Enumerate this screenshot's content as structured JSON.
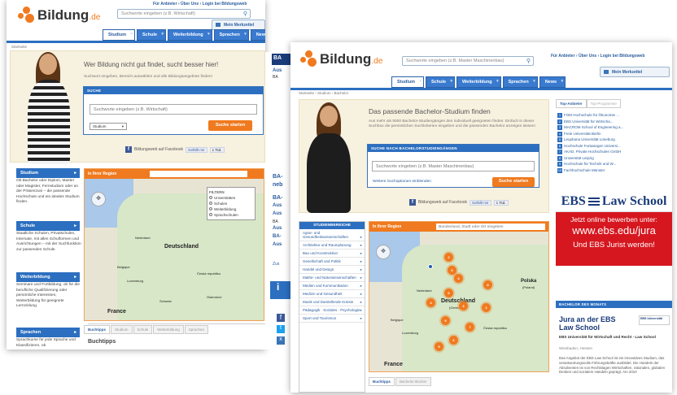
{
  "brand": {
    "name": "Bildung",
    "tld": ".de",
    "color": "#f07a1f",
    "nav_color": "#3a7bd0"
  },
  "back": {
    "search_placeholder": "Suchworte eingeben (z.B. Wirtschaft)",
    "toplinks": "Für Anbieter › Über Uns › Login bei Bildungsweb",
    "merkzettel": "Mein Merkzettel",
    "nav": [
      "Studium",
      "Schule",
      "Weiterbildung",
      "Sprachen",
      "News"
    ],
    "crumb": "Startseite",
    "slogan": "Wer Bildung nicht gut findet, sucht besser hier!",
    "sub": "Suchwort eingeben, Bereich auswählen und alle Bildungsangebote finden!",
    "suche_header": "SUCHE",
    "input": "Suchworte eingeben (z.B. Wirtschaft)",
    "select": "Studium",
    "button": "Suche starten",
    "fb_text": "Bildungsweb auf Facebook",
    "like": "Gefällt mir",
    "like_count": "1 Tsd.",
    "categories": [
      {
        "title": "Studium",
        "text": "Ob Bachelor oder Diplom, Master oder Magister, Fernstudium oder an der Präsenzuni – die passende Hochschule und ein ideales Studium finden."
      },
      {
        "title": "Schule",
        "text": "Staatliche Schulen, Privatschulen, Internate, mit allen Schulformen und Ausrichtungen – mit der Suchfunktion zur passenden Schule."
      },
      {
        "title": "Weiterbildung",
        "text": "Seminare und Fortbildung, ob für die berufliche Qualifizierung oder persönliche Interessen, Weiterbildung für geeignete Lernzielung."
      },
      {
        "title": "Sprachen",
        "text": "Sprachkurse für jede Sprache und Klassifizieren, ob"
      }
    ],
    "map_bar": "In Ihrer Region",
    "filter_title": "FILTERN",
    "filter_items": [
      "Universitäten",
      "Schulen",
      "Weiterbildung",
      "Sprachschulen"
    ],
    "map_labels": {
      "nl": "Nederland",
      "de": "Deutschland",
      "be": "Belgique",
      "lux": "Luxemburg",
      "cz": "Česká republika",
      "fr": "France",
      "ch": "Schweiz",
      "at": "Österreich"
    },
    "tabs": [
      "Buchtipps",
      "Studium",
      "Schule",
      "Weiterbildung",
      "Sprachen"
    ],
    "tab_heading": "Buchtipps",
    "side_peek": [
      "BA",
      "Aus",
      "BA",
      "BA-",
      "neb",
      "BA-",
      "Aus",
      "Aus",
      "BA",
      "Aus",
      "BA-",
      "Aus",
      "Zus"
    ]
  },
  "front": {
    "search_placeholder": "Suchworte eingeben (z.B. Master Maschinenbau)",
    "toplinks": "Für Anbieter › Über Uns › Login bei Bildungsweb",
    "merkzettel": "Mein Merkzettel",
    "nav": [
      "Studium",
      "Schule",
      "Weiterbildung",
      "Sprachen",
      "News"
    ],
    "crumb": "Startseite › Studium › Bachelor",
    "slogan": "Das passende Bachelor-Studium finden",
    "sub": "Aus mehr als 5000 Bachelor-Studiengängen den individuell geeigneten finden: Einfach in dieser Suchbox die persönlichen Suchkriterien eingeben und die passenden Bachelor anzeigen lassen!",
    "suche_header": "SUCHE NACH BACHELORSTUDIENGÄNGEN",
    "input": "Suchworte eingeben (z.B. Master Maschinenbau)",
    "weitere": "Weitere Suchoptionen einblenden",
    "button": "Suche starten",
    "fb_text": "Bildungsweb auf Facebook",
    "like": "Gefällt mir",
    "like_count": "1 Tsd.",
    "side_header": "STUDIENBEREICHE",
    "side_items": [
      "Agrar- und Gesundheitswissenschaften",
      "Architektur und Raumplanung",
      "Bau und Konstruktion",
      "Gesellschaft und Politik",
      "Handel und Design",
      "Mathe- und Naturwissenschaften",
      "Medien und Kommunikation",
      "Medizin und Gesundheit",
      "Musik und Darstellende Künste",
      "Pädagogik · Soziales · Psychologie",
      "Sport und Tourismus"
    ],
    "map_bar": "In Ihrer Region",
    "map_input": "Bundesland, Stadt oder Ort eingeben",
    "map_labels": {
      "nl": "Nederland",
      "de": "Deutschland",
      "de2": "(Germany)",
      "pl": "Polska",
      "pl2": "(Poland)",
      "be": "Belgique",
      "lux": "Luxemburg",
      "cz": "Česká republika",
      "fr": "France"
    },
    "pin_counts": [
      "2",
      "5",
      "3",
      "8",
      "6",
      "4",
      "3",
      "2",
      "9",
      "7",
      "6",
      "5"
    ],
    "tabs": [
      "Buchtipps",
      "Bachelor-Bücher"
    ],
    "right_tabs": [
      "Top-Anbieter",
      "Top-Programme"
    ],
    "top_list": [
      {
        "n": "1",
        "t": "FOM Hochschule für Ökonomie ..."
      },
      {
        "n": "2",
        "t": "EBS Universität für Wirtscha..."
      },
      {
        "n": "3",
        "t": "MACROM School of Engineering a..."
      },
      {
        "n": "4",
        "t": "Freie Universität Berlin"
      },
      {
        "n": "5",
        "t": "Leuphana Universität Lüneburg"
      },
      {
        "n": "6",
        "t": "Hochschule Furtwangen Universi..."
      },
      {
        "n": "7",
        "t": "AKAD. Private Hochschulen GmbH"
      },
      {
        "n": "8",
        "t": "Universität Leipzig"
      },
      {
        "n": "9",
        "t": "Hochschule für Technik und W..."
      },
      {
        "n": "10",
        "t": "Fachhochschule Münster"
      }
    ],
    "ad": {
      "logo_a": "EBS",
      "logo_b": "Law School",
      "l1": "Jetzt online bewerben unter:",
      "l2": "www.ebs.edu/jura",
      "l3": "Und EBS Jurist werden!",
      "red": "#d6171f",
      "navy": "#1a3c7a"
    },
    "bach_header": "BACHELOR DES MONATS",
    "bach_title1": "Jura an der EBS",
    "bach_title2": "Law School",
    "bach_logo": "EBS Universität",
    "bach_org": "EBS Universität für Wirtschaft und Recht - Law School",
    "bach_loc": "Wiesbaden, Hessen",
    "bach_text": "Das Angebot der EBS Law School ist ein innovatives Studium, das verantwortungsvolle Führungskräfte ausbildet. Die Handeln der Absolventen ist von Rechtslagen Wirtschaften, rationalen, globalen Denken und sozialem Handeln geprägt. Am 2010"
  }
}
